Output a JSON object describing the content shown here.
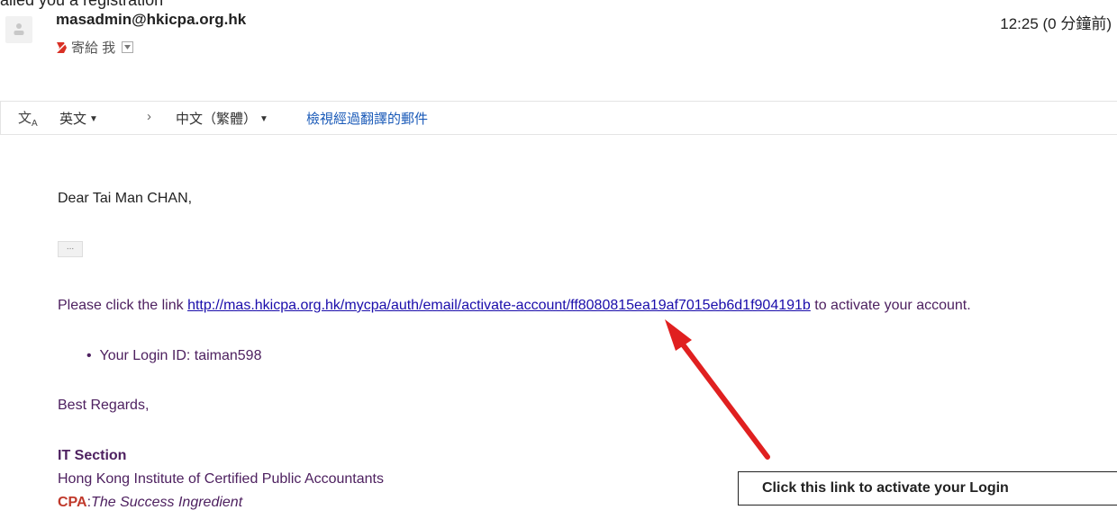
{
  "header": {
    "cut_text": "ailed you a registration",
    "sender": "masadmin@hkicpa.org.hk",
    "time": "12:25 (0 分鐘前)",
    "to_label": "寄給 我"
  },
  "translate_bar": {
    "from_lang": "英文",
    "to_lang": "中文（繁體）",
    "view_translated": "檢視經過翻譯的郵件"
  },
  "body": {
    "greeting": "Dear Tai Man CHAN,",
    "ellipsis": "...",
    "para_before": "Please click the link ",
    "link": "http://mas.hkicpa.org.hk/mycpa/auth/email/activate-account/ff8080815ea19af7015eb6d1f904191b",
    "para_after": " to activate your account.",
    "login_id": "Your Login ID: taiman598",
    "regards": "Best Regards,",
    "section": "IT Section",
    "institute": "Hong Kong Institute of Certified Public Accountants",
    "tag_cpa": "CPA",
    "tag_rest": "The Success Ingredient"
  },
  "callout": {
    "text": "Click this link to activate your Login"
  },
  "colors": {
    "link": "#1a0dab",
    "body_text": "#4e2160",
    "arrow": "#e02020"
  }
}
